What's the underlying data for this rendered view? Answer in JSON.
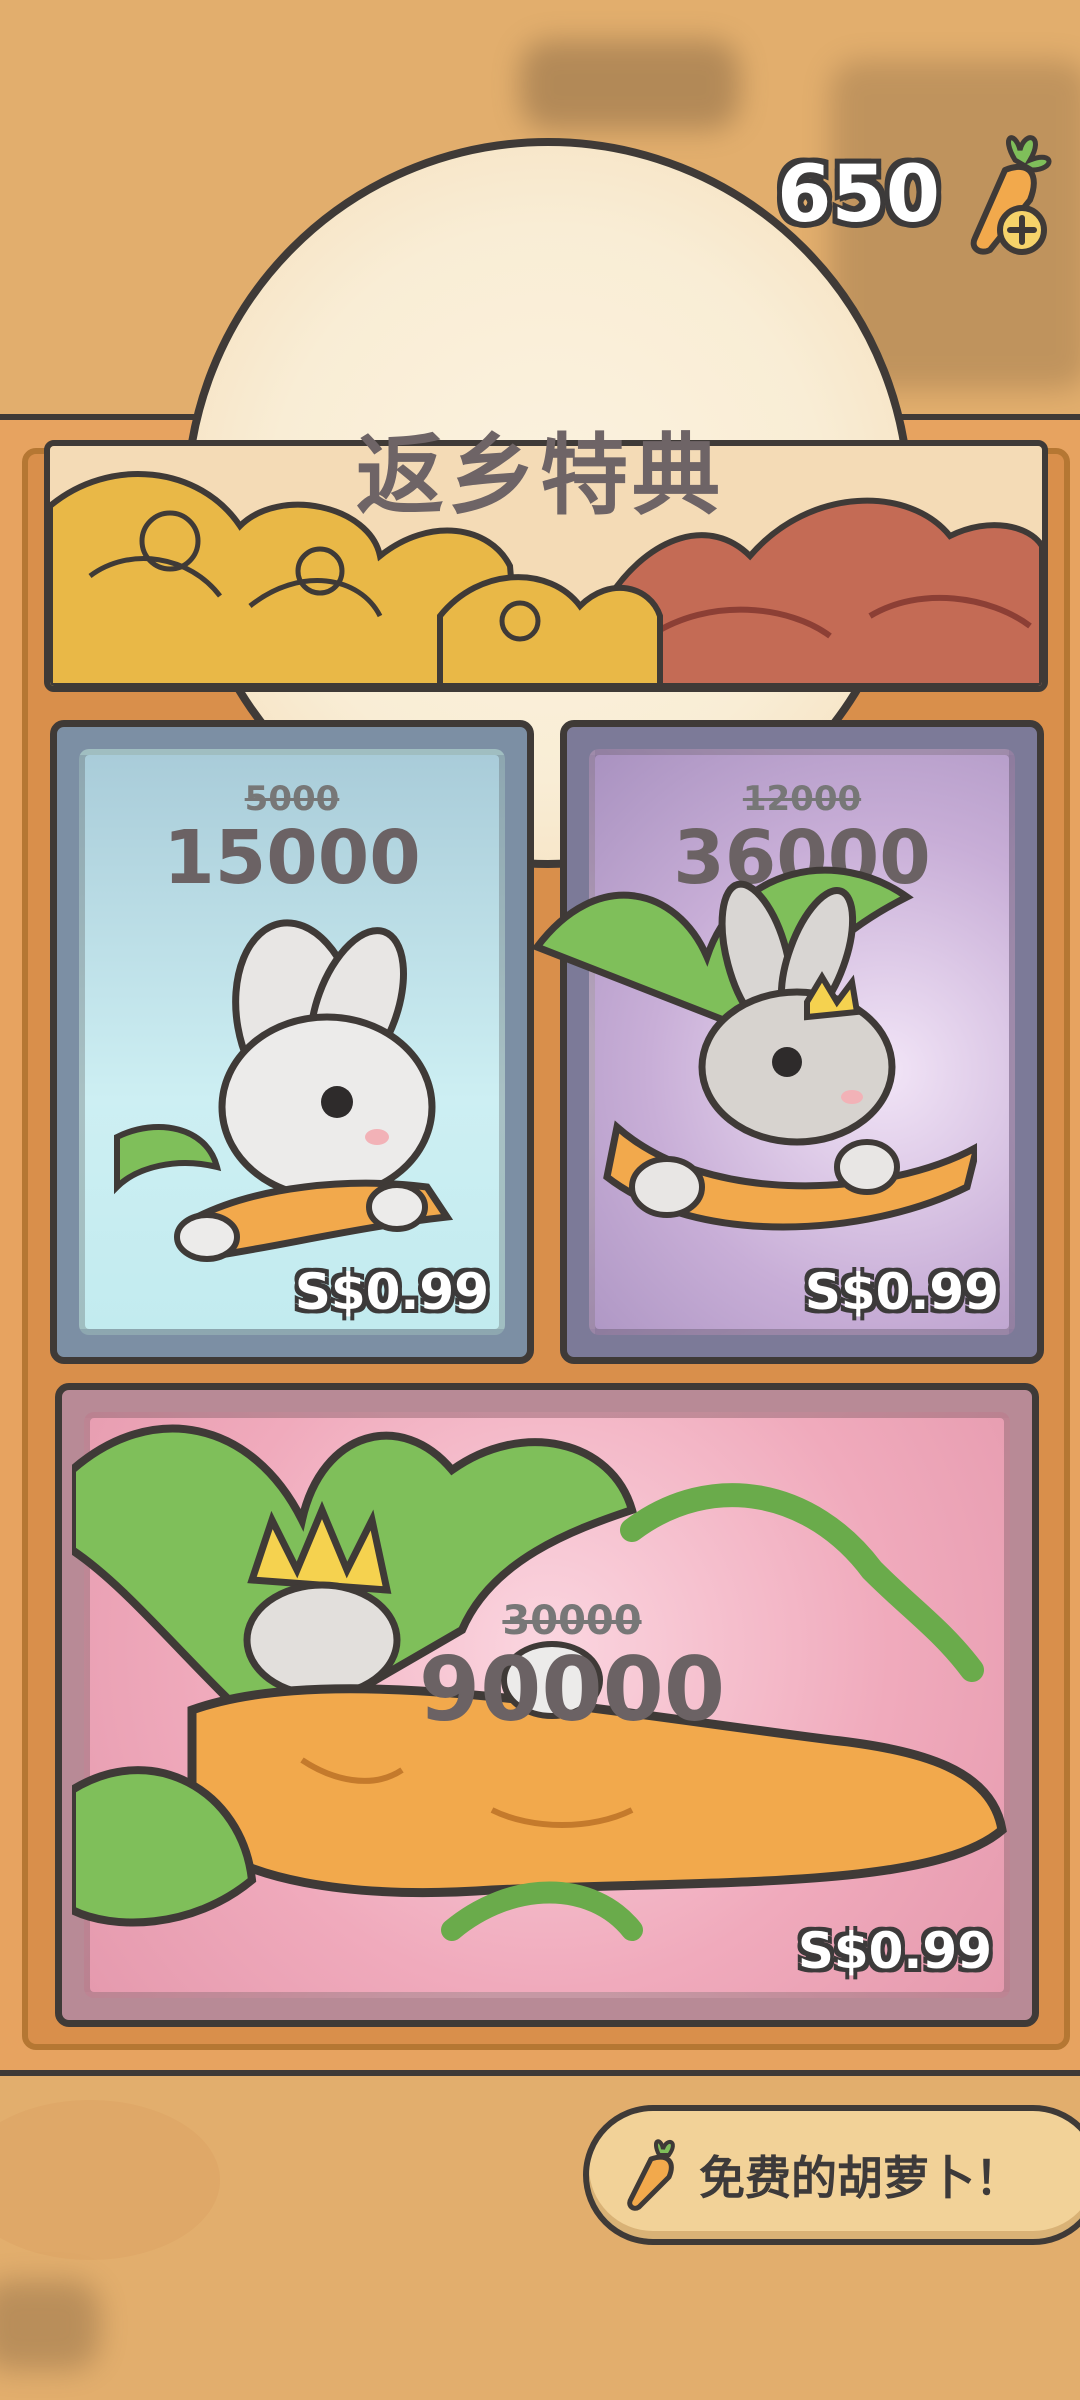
{
  "currency": {
    "amount": "650",
    "icon": "carrot-plus-icon"
  },
  "banner": {
    "title": "返乡特典"
  },
  "offers": [
    {
      "old_amount": "5000",
      "new_amount": "15000",
      "price": "S$0.99",
      "theme": "blue",
      "character": "white-rabbit"
    },
    {
      "old_amount": "12000",
      "new_amount": "36000",
      "price": "S$0.99",
      "theme": "purple",
      "character": "grey-rabbit-small-crown"
    },
    {
      "old_amount": "30000",
      "new_amount": "90000",
      "price": "S$0.99",
      "theme": "pink",
      "character": "rabbit-king-crown"
    }
  ],
  "free_button": {
    "label": "免费的胡萝卜！",
    "icon": "carrot-icon"
  },
  "colors": {
    "background": "#E2AE6D",
    "outline": "#3f3a37",
    "leaf": "#7fbf5a",
    "carrot": "#f2a94c"
  }
}
